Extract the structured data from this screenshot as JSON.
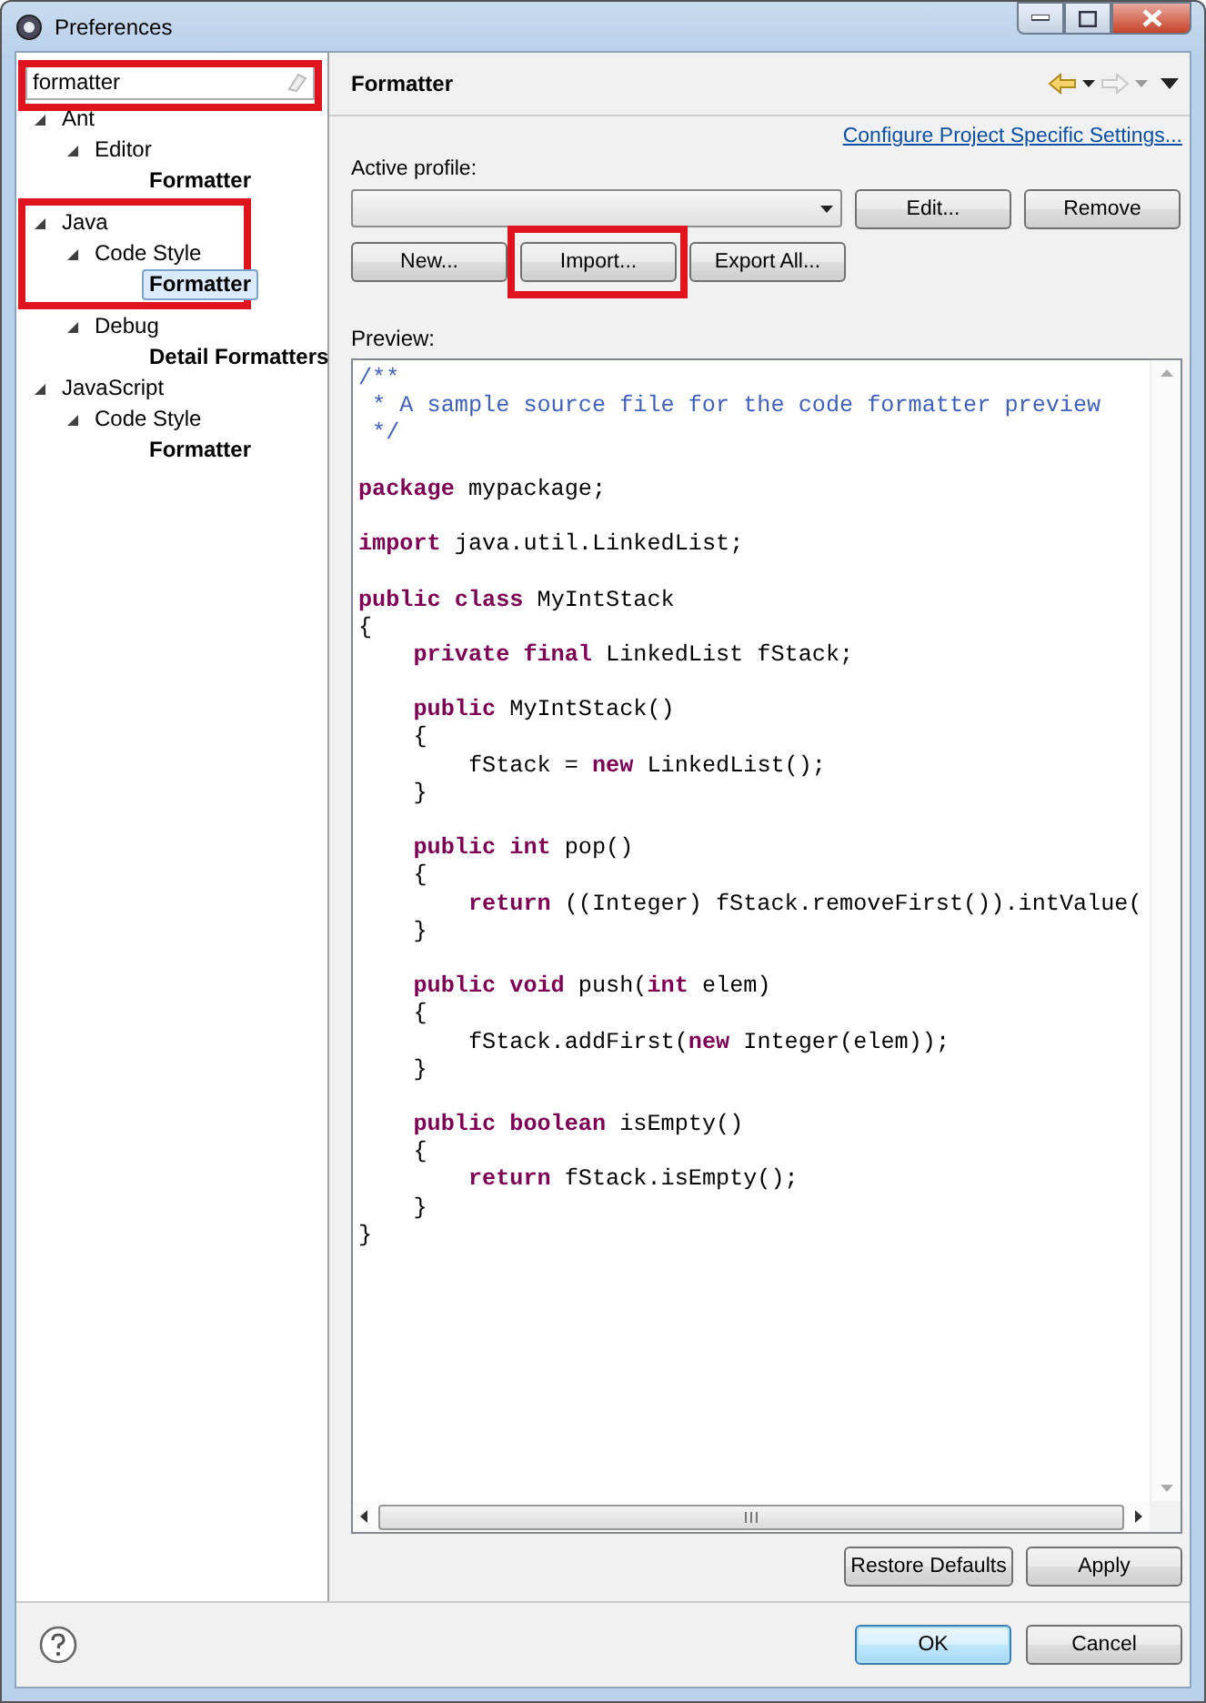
{
  "window": {
    "title": "Preferences"
  },
  "filter": {
    "value": "formatter",
    "highlighted": true
  },
  "tree": [
    {
      "label": "Ant",
      "expanded": true,
      "selected": false,
      "children": [
        {
          "label": "Editor",
          "expanded": true,
          "selected": false,
          "children": [
            {
              "label": "Formatter",
              "selected": false
            }
          ]
        }
      ]
    },
    {
      "label": "Java",
      "expanded": true,
      "selected": false,
      "highlighted": true,
      "children": [
        {
          "label": "Code Style",
          "expanded": true,
          "selected": false,
          "highlighted": true,
          "children": [
            {
              "label": "Formatter",
              "selected": true,
              "highlighted": true
            }
          ]
        },
        {
          "label": "Debug",
          "expanded": true,
          "selected": false,
          "children": [
            {
              "label": "Detail Formatters",
              "selected": false
            }
          ]
        }
      ]
    },
    {
      "label": "JavaScript",
      "expanded": true,
      "selected": false,
      "children": [
        {
          "label": "Code Style",
          "expanded": true,
          "selected": false,
          "children": [
            {
              "label": "Formatter",
              "selected": false
            }
          ]
        }
      ]
    }
  ],
  "page": {
    "title": "Formatter",
    "link": "Configure Project Specific Settings...",
    "active_profile_label": "Active profile:",
    "profile_buttons": [
      "Edit...",
      "Remove"
    ],
    "action_buttons": [
      {
        "label": "New..."
      },
      {
        "label": "Import...",
        "highlighted": true
      },
      {
        "label": "Export All..."
      }
    ],
    "preview_label": "Preview:",
    "code": [
      {
        "kind": "code",
        "tokens": [
          {
            "kind": "comment",
            "text": "/**"
          }
        ]
      },
      {
        "kind": "code",
        "tokens": [
          {
            "kind": "comment",
            "text": " * A sample source file for the code formatter preview"
          }
        ]
      },
      {
        "kind": "code",
        "tokens": [
          {
            "kind": "comment",
            "text": " */"
          }
        ]
      },
      {
        "kind": "blank"
      },
      {
        "kind": "code",
        "tokens": [
          {
            "kind": "keyword",
            "text": "package"
          },
          {
            "kind": "plain",
            "text": " mypackage;"
          }
        ]
      },
      {
        "kind": "blank"
      },
      {
        "kind": "code",
        "tokens": [
          {
            "kind": "keyword",
            "text": "import"
          },
          {
            "kind": "plain",
            "text": " java.util.LinkedList;"
          }
        ]
      },
      {
        "kind": "blank"
      },
      {
        "kind": "code",
        "tokens": [
          {
            "kind": "keyword",
            "text": "public class"
          },
          {
            "kind": "plain",
            "text": " MyIntStack"
          }
        ]
      },
      {
        "kind": "code",
        "tokens": [
          {
            "kind": "plain",
            "text": "{"
          }
        ]
      },
      {
        "kind": "code",
        "tokens": [
          {
            "kind": "keyword",
            "text": "    private final"
          },
          {
            "kind": "plain",
            "text": " LinkedList fStack;"
          }
        ]
      },
      {
        "kind": "blank"
      },
      {
        "kind": "code",
        "tokens": [
          {
            "kind": "keyword",
            "text": "    public"
          },
          {
            "kind": "plain",
            "text": " MyIntStack()"
          }
        ]
      },
      {
        "kind": "code",
        "tokens": [
          {
            "kind": "plain",
            "text": "    {"
          }
        ]
      },
      {
        "kind": "code",
        "tokens": [
          {
            "kind": "plain",
            "text": "        fStack = "
          },
          {
            "kind": "keyword",
            "text": "new"
          },
          {
            "kind": "plain",
            "text": " LinkedList();"
          }
        ]
      },
      {
        "kind": "code",
        "tokens": [
          {
            "kind": "plain",
            "text": "    }"
          }
        ]
      },
      {
        "kind": "blank"
      },
      {
        "kind": "code",
        "tokens": [
          {
            "kind": "keyword",
            "text": "    public int"
          },
          {
            "kind": "plain",
            "text": " pop()"
          }
        ]
      },
      {
        "kind": "code",
        "tokens": [
          {
            "kind": "plain",
            "text": "    {"
          }
        ]
      },
      {
        "kind": "code",
        "tokens": [
          {
            "kind": "keyword",
            "text": "        return"
          },
          {
            "kind": "plain",
            "text": " ((Integer) fStack.removeFirst()).intValue("
          }
        ]
      },
      {
        "kind": "code",
        "tokens": [
          {
            "kind": "plain",
            "text": "    }"
          }
        ]
      },
      {
        "kind": "blank"
      },
      {
        "kind": "code",
        "tokens": [
          {
            "kind": "keyword",
            "text": "    public void"
          },
          {
            "kind": "plain",
            "text": " push("
          },
          {
            "kind": "keyword",
            "text": "int"
          },
          {
            "kind": "plain",
            "text": " elem)"
          }
        ]
      },
      {
        "kind": "code",
        "tokens": [
          {
            "kind": "plain",
            "text": "    {"
          }
        ]
      },
      {
        "kind": "code",
        "tokens": [
          {
            "kind": "plain",
            "text": "        fStack.addFirst("
          },
          {
            "kind": "keyword",
            "text": "new"
          },
          {
            "kind": "plain",
            "text": " Integer(elem));"
          }
        ]
      },
      {
        "kind": "code",
        "tokens": [
          {
            "kind": "plain",
            "text": "    }"
          }
        ]
      },
      {
        "kind": "blank"
      },
      {
        "kind": "code",
        "tokens": [
          {
            "kind": "keyword",
            "text": "    public boolean"
          },
          {
            "kind": "plain",
            "text": " isEmpty()"
          }
        ]
      },
      {
        "kind": "code",
        "tokens": [
          {
            "kind": "plain",
            "text": "    {"
          }
        ]
      },
      {
        "kind": "code",
        "tokens": [
          {
            "kind": "keyword",
            "text": "        return"
          },
          {
            "kind": "plain",
            "text": " fStack.isEmpty();"
          }
        ]
      },
      {
        "kind": "code",
        "tokens": [
          {
            "kind": "plain",
            "text": "    }"
          }
        ]
      },
      {
        "kind": "code",
        "tokens": [
          {
            "kind": "plain",
            "text": "}"
          }
        ]
      }
    ]
  },
  "page_buttons": [
    "Restore Defaults",
    "Apply"
  ],
  "dialog_buttons": [
    {
      "label": "OK",
      "default": true
    },
    {
      "label": "Cancel",
      "default": false
    }
  ]
}
